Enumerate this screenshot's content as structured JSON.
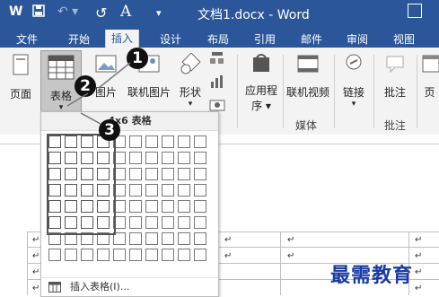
{
  "window": {
    "title": "文档1.docx - Word"
  },
  "qat": {
    "word_icon": "W",
    "save_icon": "💾",
    "undo": "↶ ▾",
    "redo": "↺",
    "format": "A",
    "more": "▾"
  },
  "tabs": [
    "文件",
    "开始",
    "插入",
    "设计",
    "布局",
    "引用",
    "邮件",
    "审阅",
    "视图"
  ],
  "active_tab": "插入",
  "ribbon": {
    "page": "页面",
    "table": "表格",
    "table_arrow": "▾",
    "picture": "图片",
    "online_picture": "联机图片",
    "shapes": "形状",
    "shapes_arrow": "▾",
    "apps_line1": "应用程",
    "apps_line2": "序 ▾",
    "online_video": "联机视频",
    "link": "链接",
    "link_arrow": "▾",
    "comment": "批注",
    "header_short": "页",
    "group_media": "媒体",
    "group_comment": "批注"
  },
  "dropdown": {
    "header": "4x6 表格",
    "insert_table": "插入表格(I)...",
    "grid_cols": 10,
    "grid_rows": 8,
    "selected_cols": 4,
    "selected_rows": 6
  },
  "callouts": [
    "1",
    "2",
    "3"
  ],
  "document": {
    "paragraph_mark": "↵"
  },
  "watermark": "最需教育"
}
